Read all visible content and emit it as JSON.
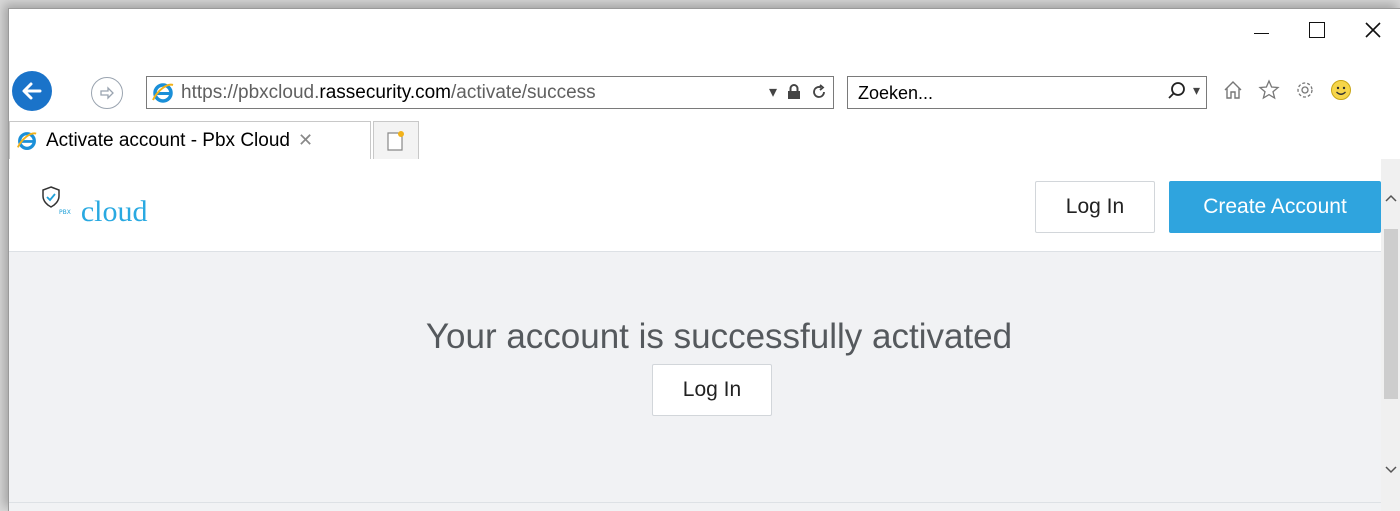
{
  "browser": {
    "caption": {
      "minimize": "–",
      "maximize": "□",
      "close": "✕"
    },
    "address": {
      "scheme": "https://",
      "subdomain": "pbxcloud.",
      "domain": "rassecurity.com",
      "path": "/activate/success"
    },
    "search": {
      "placeholder": "Zoeken..."
    },
    "tab": {
      "title": "Activate account - Pbx Cloud",
      "close": "✕"
    },
    "icons": [
      "back-icon",
      "forward-icon",
      "ie-icon",
      "dropdown-icon",
      "lock-icon",
      "refresh-icon",
      "search-icon",
      "home-icon",
      "favorites-icon",
      "settings-icon",
      "smiley-icon",
      "new-tab-icon"
    ],
    "accent": "#1a73c9"
  },
  "site": {
    "logo": {
      "sub": "PBX",
      "word": "cloud"
    },
    "nav": {
      "login": "Log In",
      "create_account": "Create Account"
    },
    "main": {
      "message": "Your account is successfully activated",
      "login": "Log In"
    },
    "colors": {
      "brand": "#29a9e1",
      "primary_button": "#2fa4de",
      "background": "#f1f2f4"
    }
  }
}
